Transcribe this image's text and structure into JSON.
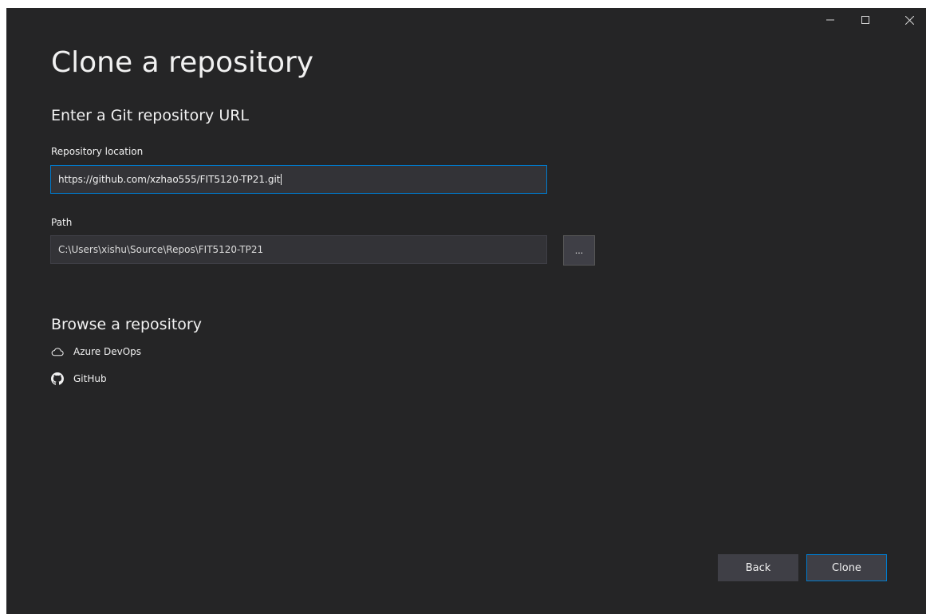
{
  "window": {
    "caption_buttons": [
      "minimize-icon",
      "maximize-icon",
      "close-icon"
    ]
  },
  "page": {
    "title": "Clone a repository"
  },
  "clone_section": {
    "heading": "Enter a Git repository URL",
    "repository_location": {
      "label": "Repository location",
      "value": "https://github.com/xzhao555/FIT5120-TP21.git"
    },
    "path": {
      "label": "Path",
      "value": "C:\\Users\\xishu\\Source\\Repos\\FIT5120-TP21",
      "browse_label": "..."
    }
  },
  "browse_section": {
    "heading": "Browse a repository",
    "providers": [
      {
        "label": "Azure DevOps",
        "icon": "cloud-icon"
      },
      {
        "label": "GitHub",
        "icon": "github-icon"
      }
    ]
  },
  "footer": {
    "back_label": "Back",
    "clone_label": "Clone"
  },
  "colors": {
    "background": "#252526",
    "input_background": "#333337",
    "accent": "#007acc",
    "button_background": "#3f3f46",
    "text": "#f1f1f1"
  }
}
